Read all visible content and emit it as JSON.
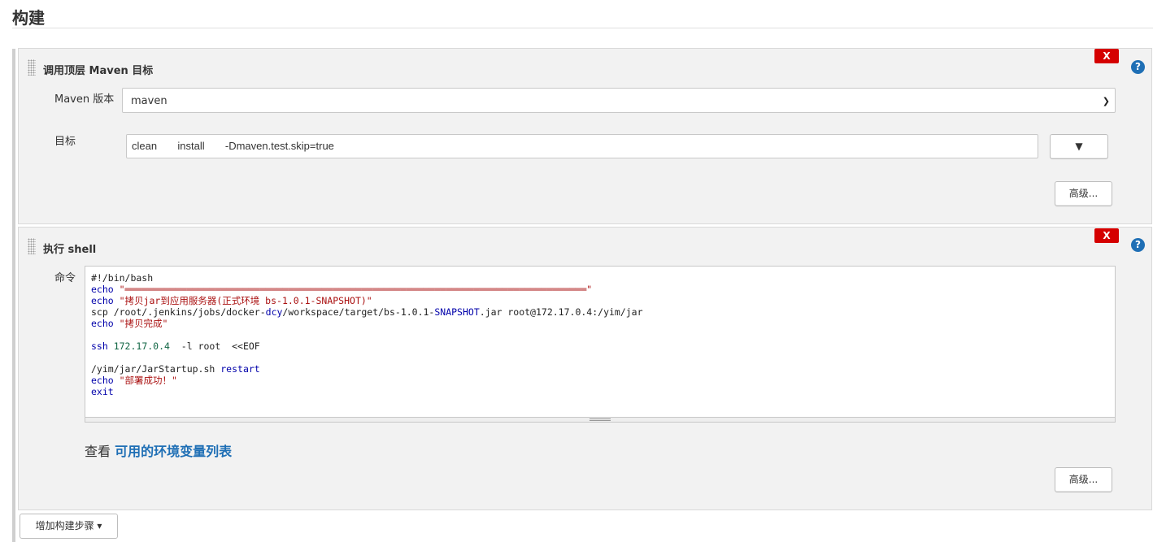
{
  "section": {
    "title": "构建"
  },
  "steps": [
    {
      "title": "调用顶层 Maven 目标",
      "delete_label": "X",
      "help_label": "?",
      "maven_version_label": "Maven 版本",
      "maven_version_value": "maven",
      "goals_label": "目标",
      "goals_value": "clean       install       -Dmaven.test.skip=true",
      "goals_dropdown_icon": "▼",
      "advanced_label": "高级..."
    },
    {
      "title": "执行 shell",
      "delete_label": "X",
      "help_label": "?",
      "command_label": "命令",
      "command_lines": [
        [
          {
            "t": "#!/bin/bash",
            "c": "plain"
          }
        ],
        [
          {
            "t": "echo",
            "c": "kw"
          },
          {
            "t": " \"══════════════════════════════════════════════════════════════════════════════════\"",
            "c": "str"
          }
        ],
        [
          {
            "t": "echo",
            "c": "kw"
          },
          {
            "t": " \"拷贝jar到应用服务器(正式环境 bs-1.0.1-SNAPSHOT)\"",
            "c": "str"
          }
        ],
        [
          {
            "t": "scp /root/.jenkins/jobs/docker-",
            "c": "plain"
          },
          {
            "t": "dcy",
            "c": "kw"
          },
          {
            "t": "/workspace/target/bs-1.0.1-",
            "c": "plain"
          },
          {
            "t": "SNAPSHOT",
            "c": "kw"
          },
          {
            "t": ".jar root@172.17.0.4:/yim/jar",
            "c": "plain"
          }
        ],
        [
          {
            "t": "echo",
            "c": "kw"
          },
          {
            "t": " \"拷贝完成\"",
            "c": "str"
          }
        ],
        [
          {
            "t": "",
            "c": "plain"
          }
        ],
        [
          {
            "t": "ssh",
            "c": "kw"
          },
          {
            "t": " 172.17.0.4",
            "c": "num"
          },
          {
            "t": "  -l root  <<EOF",
            "c": "plain"
          }
        ],
        [
          {
            "t": "",
            "c": "plain"
          }
        ],
        [
          {
            "t": "/yim/jar/JarStartup.sh ",
            "c": "plain"
          },
          {
            "t": "restart",
            "c": "kw"
          }
        ],
        [
          {
            "t": "echo",
            "c": "kw"
          },
          {
            "t": " \"部署成功！\"",
            "c": "str"
          }
        ],
        [
          {
            "t": "exit",
            "c": "kw"
          }
        ]
      ],
      "env_prefix": "查看 ",
      "env_link": "可用的环境变量列表",
      "advanced_label": "高级..."
    }
  ],
  "add_step": {
    "label": "增加构建步骤 ▾"
  },
  "icons": {
    "grip": "drag-handle-icon",
    "help": "help-icon",
    "delete": "delete-icon",
    "dropdown": "chevron-down-icon"
  },
  "colors": {
    "delete_bg": "#d50000",
    "help_bg": "#1f6fb5",
    "link": "#1f6fb5",
    "panel_bg": "#f2f2f2"
  }
}
